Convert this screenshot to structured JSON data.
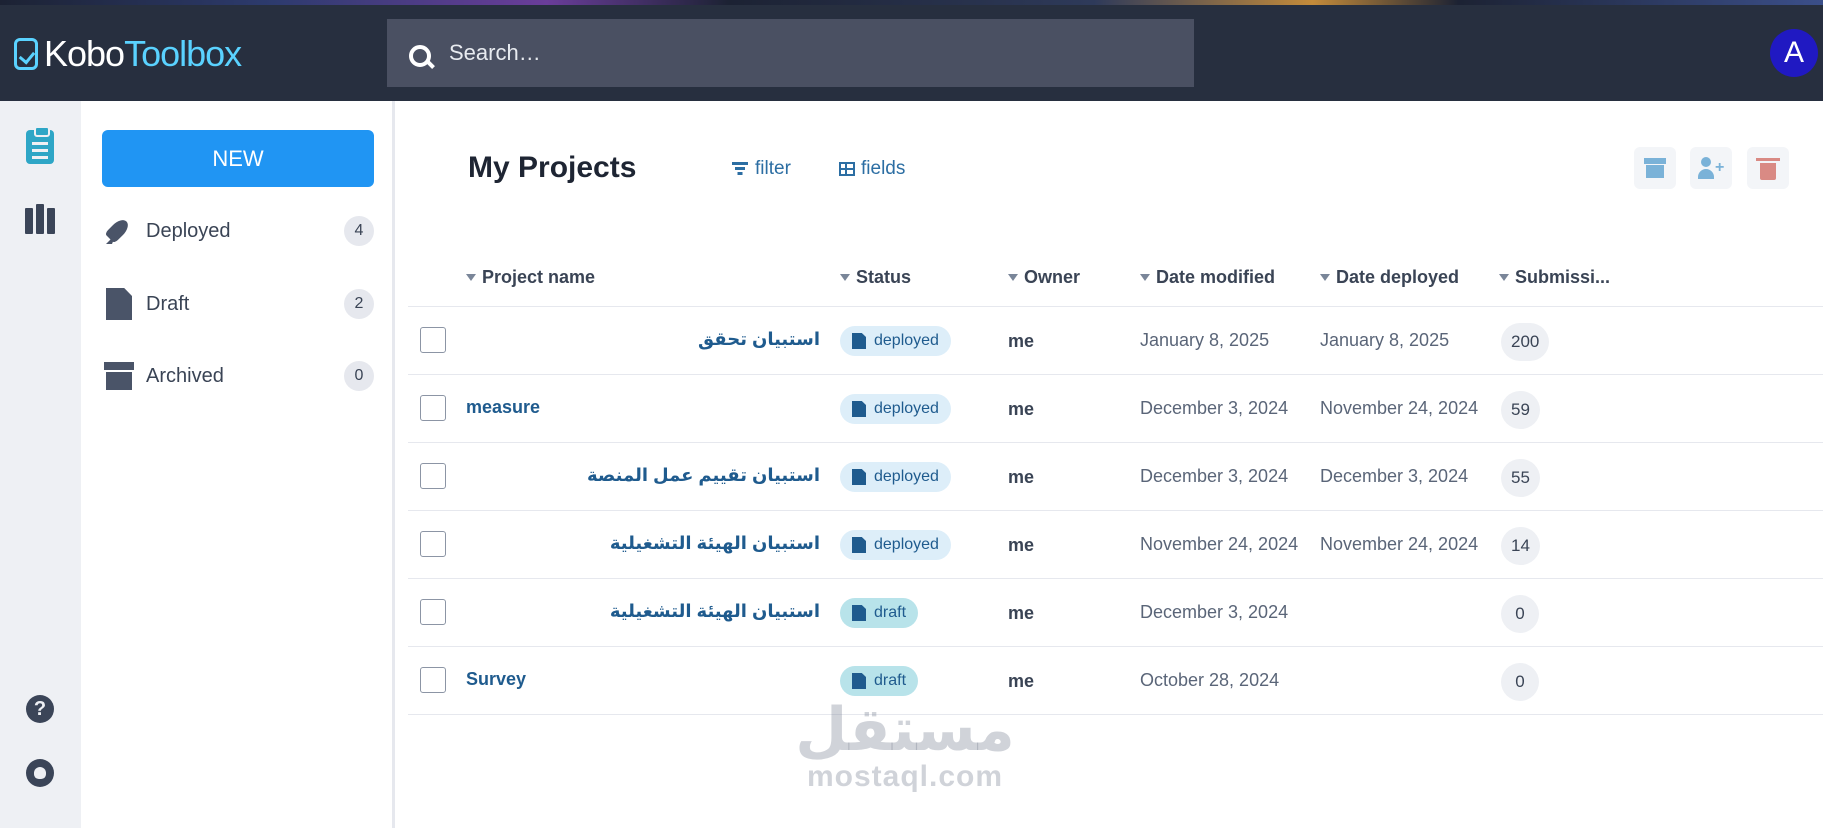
{
  "app": {
    "logo_kobo": "Kobo",
    "logo_toolbox": "Toolbox",
    "avatar_letter": "A"
  },
  "search": {
    "placeholder": "Search…"
  },
  "rail": {
    "icons": [
      "forms-icon",
      "library-icon",
      "help-icon",
      "github-icon"
    ],
    "accent": "#2ea6c6"
  },
  "sidebar": {
    "new_label": "NEW",
    "items": [
      {
        "label": "Deployed",
        "count": "4",
        "icon": "rocket-icon"
      },
      {
        "label": "Draft",
        "count": "2",
        "icon": "draft-icon"
      },
      {
        "label": "Archived",
        "count": "0",
        "icon": "archive-icon"
      }
    ]
  },
  "main": {
    "title": "My Projects",
    "filter_label": "filter",
    "fields_label": "fields",
    "actions": [
      "archive-icon",
      "share-user-icon",
      "trash-icon"
    ]
  },
  "table": {
    "columns": [
      "Project name",
      "Status",
      "Owner",
      "Date modified",
      "Date deployed",
      "Submissi..."
    ],
    "rows": [
      {
        "name": "استبيان تحقق",
        "rtl": true,
        "status": "deployed",
        "owner": "me",
        "date_modified": "January 8, 2025",
        "date_deployed": "January 8, 2025",
        "submissions": "200"
      },
      {
        "name": "measure",
        "rtl": false,
        "status": "deployed",
        "owner": "me",
        "date_modified": "December 3, 2024",
        "date_deployed": "November 24, 2024",
        "submissions": "59"
      },
      {
        "name": "استبيان تقييم عمل المنصة",
        "rtl": true,
        "status": "deployed",
        "owner": "me",
        "date_modified": "December 3, 2024",
        "date_deployed": "December 3, 2024",
        "submissions": "55"
      },
      {
        "name": "استبيان الهيئة التشغيلية",
        "rtl": true,
        "status": "deployed",
        "owner": "me",
        "date_modified": "November 24, 2024",
        "date_deployed": "November 24, 2024",
        "submissions": "14"
      },
      {
        "name": "استبيان الهيئة التشغيلية",
        "rtl": true,
        "status": "draft",
        "owner": "me",
        "date_modified": "December 3, 2024",
        "date_deployed": "",
        "submissions": "0"
      },
      {
        "name": "Survey",
        "rtl": false,
        "status": "draft",
        "owner": "me",
        "date_modified": "October 28, 2024",
        "date_deployed": "",
        "submissions": "0"
      }
    ]
  },
  "watermark": {
    "arabic": "مستقل",
    "latin": "mostaql.com"
  },
  "colors": {
    "topbar": "#272f3f",
    "brand": "#5ad2ff",
    "new_button": "#2095f3",
    "link": "#1f5b8e",
    "avatar": "#2019c2"
  }
}
